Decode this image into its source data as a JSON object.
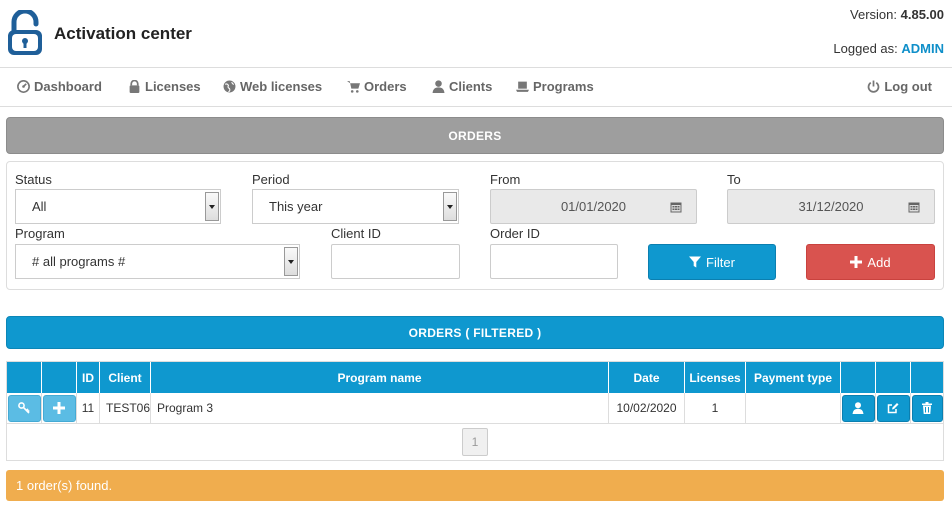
{
  "header": {
    "title": "Activation center",
    "version_label": "Version:",
    "version": "4.85.00",
    "logged_label": "Logged as:",
    "user": "ADMIN"
  },
  "nav": {
    "items": [
      {
        "label": "Dashboard",
        "icon": "dashboard-icon"
      },
      {
        "label": "Licenses",
        "icon": "lock-icon"
      },
      {
        "label": "Web licenses",
        "icon": "globe-icon"
      },
      {
        "label": "Orders",
        "icon": "cart-icon"
      },
      {
        "label": "Clients",
        "icon": "user-icon"
      },
      {
        "label": "Programs",
        "icon": "laptop-icon"
      }
    ],
    "logout": "Log out"
  },
  "orders_panel": {
    "title": "ORDERS"
  },
  "filters": {
    "status_label": "Status",
    "status_value": "All",
    "period_label": "Period",
    "period_value": "This year",
    "from_label": "From",
    "from_value": "01/01/2020",
    "to_label": "To",
    "to_value": "31/12/2020",
    "program_label": "Program",
    "program_value": "# all programs #",
    "client_id_label": "Client ID",
    "client_id_value": "",
    "order_id_label": "Order ID",
    "order_id_value": "",
    "filter_button": "Filter",
    "add_button": "Add"
  },
  "results_panel": {
    "title": "ORDERS ( FILTERED )"
  },
  "table": {
    "columns": {
      "id": "ID",
      "client": "Client",
      "program": "Program name",
      "date": "Date",
      "licenses": "Licenses",
      "payment": "Payment type"
    },
    "rows": [
      {
        "id": "11",
        "client": "TEST06",
        "program": "Program 3",
        "date": "10/02/2020",
        "licenses": "1",
        "payment": ""
      }
    ],
    "page": "1"
  },
  "status": {
    "message": "1 order(s) found."
  },
  "colors": {
    "primary": "#0f98cf",
    "danger": "#d9534f",
    "warning": "#f0ad4e",
    "panel_gray": "#9e9e9e"
  }
}
